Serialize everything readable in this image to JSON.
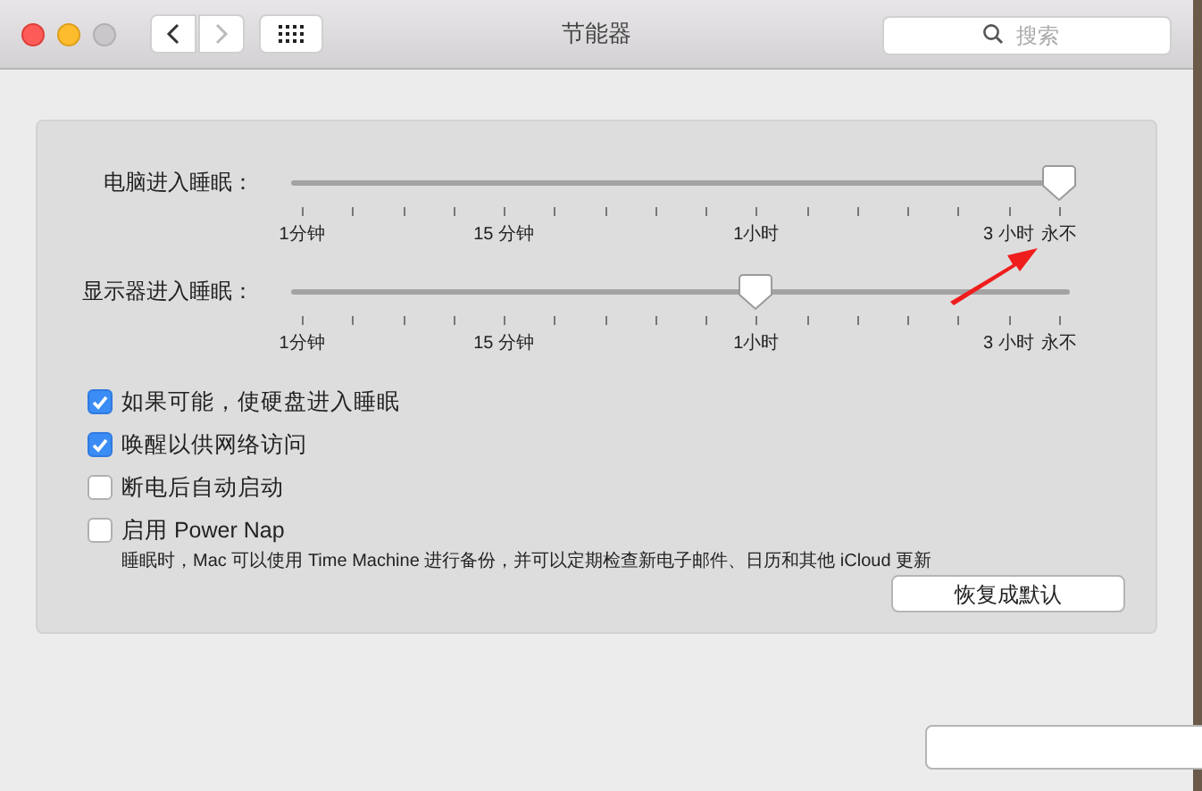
{
  "window": {
    "title": "节能器",
    "back": {
      "disabled": false
    },
    "forward": {
      "disabled": true
    },
    "search": {
      "placeholder": "搜索"
    }
  },
  "sliders": [
    {
      "label": "电脑进入睡眠：",
      "level": 1,
      "tick_labels": [
        "1分钟",
        "15 分钟",
        "1小时",
        "3 小时",
        "永不"
      ]
    },
    {
      "label": "显示器进入睡眠：",
      "level": 0.6,
      "tick_labels": [
        "1分钟",
        "15 分钟",
        "1小时",
        "3 小时",
        "永不"
      ]
    }
  ],
  "options": [
    {
      "label": "如果可能，使硬盘进入睡眠",
      "checked": true
    },
    {
      "label": "唤醒以供网络访问",
      "checked": true
    },
    {
      "label": "断电后自动启动",
      "checked": false
    },
    {
      "label": "启用 Power Nap",
      "checked": false,
      "description": "睡眠时，Mac 可以使用 Time Machine 进行备份，并可以定期检查新电子邮件、日历和其他 iCloud 更新"
    }
  ],
  "restore_button": "恢复成默认"
}
